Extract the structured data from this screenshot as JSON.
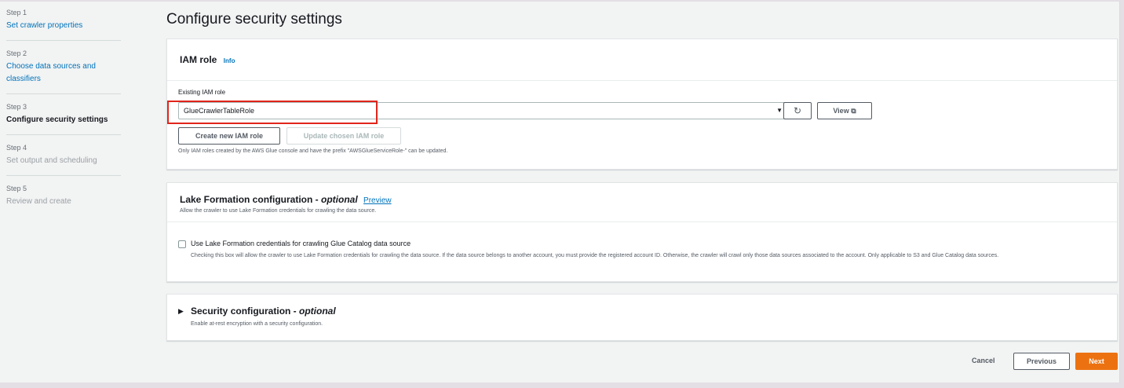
{
  "sidebar": {
    "steps": [
      {
        "num": "Step 1",
        "title": "Set crawler properties"
      },
      {
        "num": "Step 2",
        "title": "Choose data sources and classifiers"
      },
      {
        "num": "Step 3",
        "title": "Configure security settings"
      },
      {
        "num": "Step 4",
        "title": "Set output and scheduling"
      },
      {
        "num": "Step 5",
        "title": "Review and create"
      }
    ]
  },
  "main": {
    "title": "Configure security settings"
  },
  "iam": {
    "title": "IAM role",
    "info": "Info",
    "field_label": "Existing IAM role",
    "selected": "GlueCrawlerTableRole",
    "view_label": "View",
    "create_label": "Create new IAM role",
    "update_label": "Update chosen IAM role",
    "note": "Only IAM roles created by the AWS Glue console and have the prefix \"AWSGlueServiceRole-\" can be updated."
  },
  "lake": {
    "title_main": "Lake Formation configuration - ",
    "title_italic": "optional",
    "preview": "Preview",
    "desc": "Allow the crawler to use Lake Formation credentials for crawling the data source.",
    "checkbox_label": "Use Lake Formation credentials for crawling Glue Catalog data source",
    "checkbox_desc": "Checking this box will allow the crawler to use Lake Formation credentials for crawling the data source. If the data source belongs to another account, you must provide the registered account ID. Otherwise, the crawler will crawl only those data sources associated to the account. Only applicable to S3 and Glue Catalog data sources."
  },
  "security": {
    "title_main": "Security configuration - ",
    "title_italic": "optional",
    "desc": "Enable at-rest encryption with a security configuration."
  },
  "footer": {
    "cancel": "Cancel",
    "previous": "Previous",
    "next": "Next"
  },
  "colors": {
    "link": "#0073bb",
    "primary": "#ec7211",
    "highlight": "#e0251b"
  }
}
